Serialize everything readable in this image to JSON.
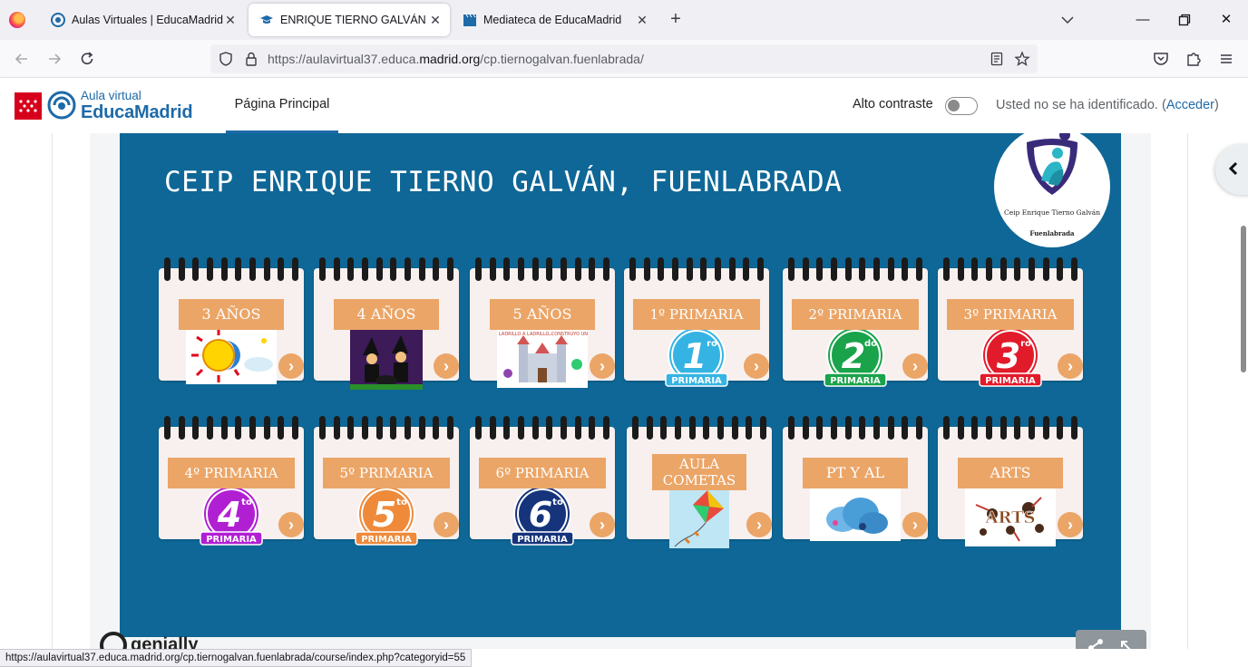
{
  "browser": {
    "tabs": [
      {
        "title": "Aulas Virtuales | EducaMadrid",
        "active": false
      },
      {
        "title": "ENRIQUE TIERNO GALVÁN",
        "active": true
      },
      {
        "title": "Mediateca de EducaMadrid",
        "active": false
      }
    ],
    "url_prefix": "https://aulavirtual37.educa.",
    "url_domain": "madrid.org",
    "url_suffix": "/cp.tiernogalvan.fuenlabrada/",
    "status_url": "https://aulavirtual37.educa.madrid.org/cp.tiernogalvan.fuenlabrada/course/index.php?categoryid=55"
  },
  "header": {
    "logo_line1": "Aula virtual",
    "logo_line2": "EducaMadrid",
    "nav_item": "Página Principal",
    "contrast_label": "Alto contraste",
    "login_prefix": "Usted no se ha identificado. (",
    "login_link": "Acceder",
    "login_suffix": ")"
  },
  "banner": {
    "title": "CEIP ENRIQUE TIERNO GALVÁN, FUENLABRADA",
    "badge_line1": "Ceip Enrique Tierno Galván",
    "badge_line2": "Fuenlabrada"
  },
  "cards": [
    {
      "label": "3 AÑOS",
      "image": "sun-moon-image"
    },
    {
      "label": "4 AÑOS",
      "image": "witches-image"
    },
    {
      "label": "5 AÑOS",
      "image": "castle-image",
      "caption_left": "LADRILLO A LADRILLO...",
      "caption_right": "...CONSTRUYO UN CASTILLO"
    },
    {
      "label": "1º PRIMARIA",
      "image": "grade-badge",
      "num": "1",
      "sup": "ro",
      "color": "#35b4e3",
      "badge_text": "PRIMARIA"
    },
    {
      "label": "2º PRIMARIA",
      "image": "grade-badge",
      "num": "2",
      "sup": "do",
      "color": "#1aa34a",
      "badge_text": "PRIMARIA"
    },
    {
      "label": "3º PRIMARIA",
      "image": "grade-badge",
      "num": "3",
      "sup": "ro",
      "color": "#e21b2b",
      "badge_text": "PRIMARIA"
    },
    {
      "label": "4º PRIMARIA",
      "image": "grade-badge",
      "num": "4",
      "sup": "to",
      "color": "#b11fd3",
      "badge_text": "PRIMARIA"
    },
    {
      "label": "5º PRIMARIA",
      "image": "grade-badge",
      "num": "5",
      "sup": "to",
      "color": "#ee8a3a",
      "badge_text": "PRIMARIA"
    },
    {
      "label": "6º PRIMARIA",
      "image": "grade-badge",
      "num": "6",
      "sup": "to",
      "color": "#16347c",
      "badge_text": "PRIMARIA"
    },
    {
      "label": "AULA COMETAS",
      "image": "kite-image"
    },
    {
      "label": "PT Y AL",
      "image": "cloud-image"
    },
    {
      "label": "ARTS",
      "image": "arts-image",
      "img_text": "ARTS"
    }
  ],
  "footer": {
    "brand": "genially"
  },
  "colors": {
    "banner_bg": "#0e6796",
    "label_bg": "#eba567",
    "accent": "#1e6aa8"
  }
}
